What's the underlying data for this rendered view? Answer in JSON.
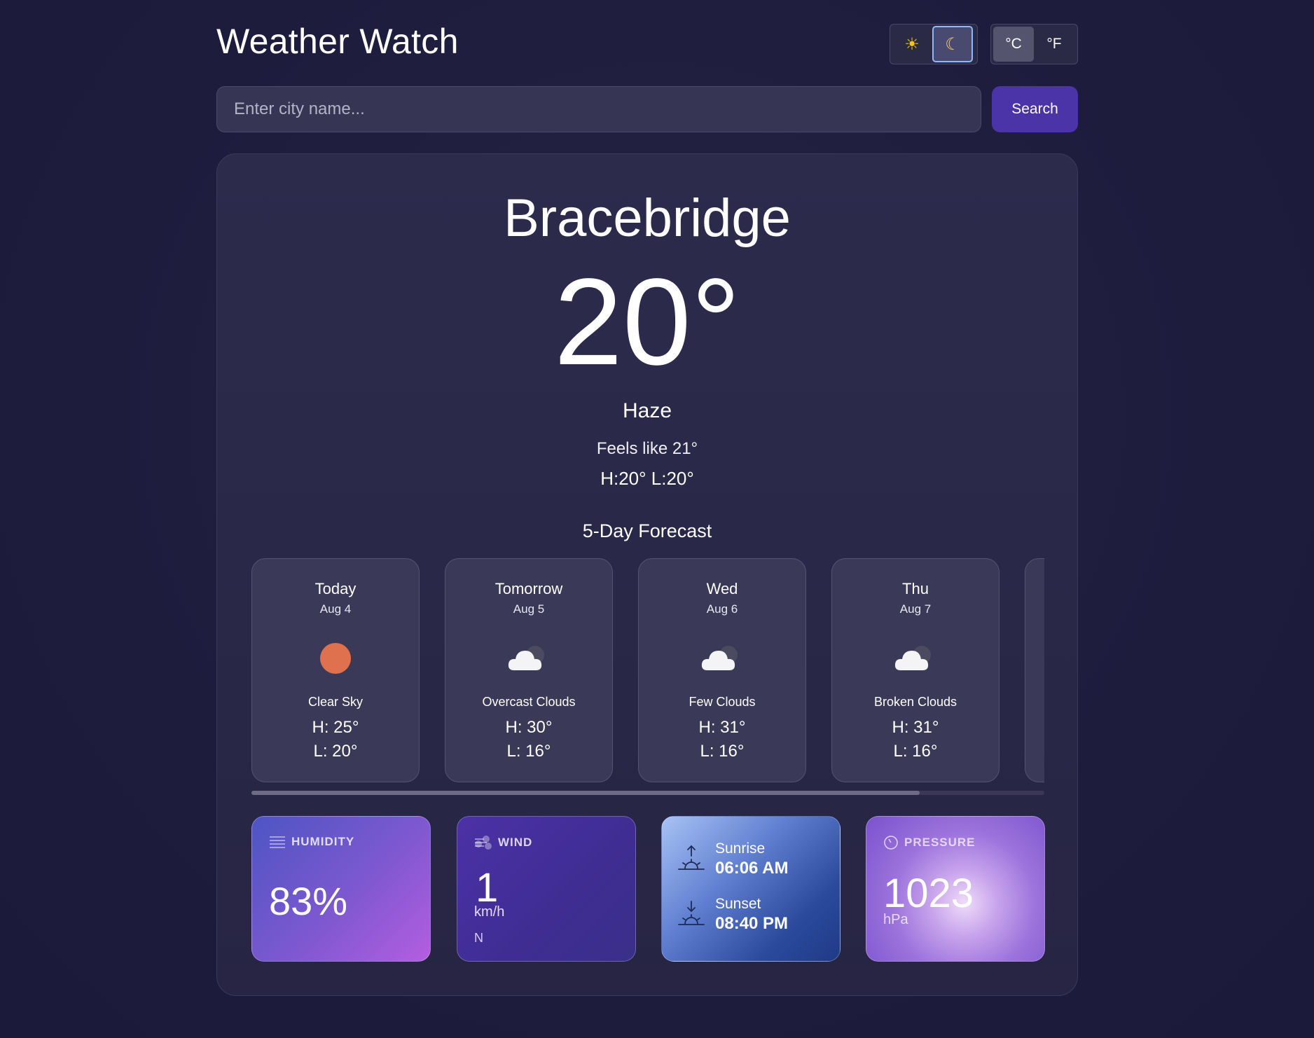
{
  "header": {
    "title": "Weather Watch",
    "theme": {
      "light_icon": "☀",
      "dark_icon": "☾",
      "active": "dark"
    },
    "units": {
      "celsius": "°C",
      "fahrenheit": "°F",
      "active": "celsius"
    }
  },
  "search": {
    "placeholder": "Enter city name...",
    "value": "",
    "button_label": "Search"
  },
  "current": {
    "city": "Bracebridge",
    "temperature": "20°",
    "condition": "Haze",
    "feels_like": "Feels like 21°",
    "high_low": "H:20° L:20°"
  },
  "forecast": {
    "title": "5-Day Forecast",
    "days": [
      {
        "day": "Today",
        "date": "Aug 4",
        "icon": "sun-icon",
        "description": "Clear Sky",
        "high": "H: 25°",
        "low": "L: 20°"
      },
      {
        "day": "Tomorrow",
        "date": "Aug 5",
        "icon": "cloud-icon",
        "description": "Overcast Clouds",
        "high": "H: 30°",
        "low": "L: 16°"
      },
      {
        "day": "Wed",
        "date": "Aug 6",
        "icon": "cloud-icon",
        "description": "Few Clouds",
        "high": "H: 31°",
        "low": "L: 16°"
      },
      {
        "day": "Thu",
        "date": "Aug 7",
        "icon": "cloud-icon",
        "description": "Broken Clouds",
        "high": "H: 31°",
        "low": "L: 16°"
      },
      {
        "day": "",
        "date": "",
        "icon": "",
        "description": "",
        "high": "",
        "low": ""
      }
    ]
  },
  "details": {
    "humidity": {
      "label": "HUMIDITY",
      "value": "83%"
    },
    "wind": {
      "label": "WIND",
      "value": "1",
      "unit": "km/h",
      "direction": "N"
    },
    "sun": {
      "sunrise_label": "Sunrise",
      "sunrise_time": "06:06 AM",
      "sunset_label": "Sunset",
      "sunset_time": "08:40 PM"
    },
    "pressure": {
      "label": "PRESSURE",
      "value": "1023",
      "unit": "hPa"
    }
  },
  "colors": {
    "background": "#1e1c3d",
    "card": "#2d2b4c",
    "accent": "#4a34a8",
    "sun": "#e0714f"
  }
}
